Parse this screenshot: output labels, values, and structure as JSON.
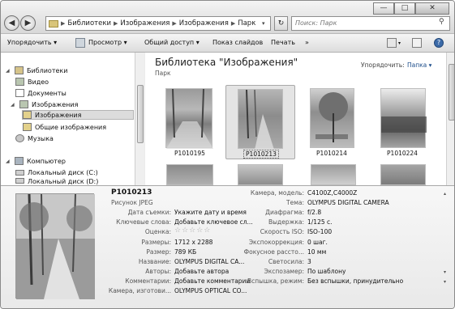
{
  "address": {
    "breadcrumb": [
      "Библиотеки",
      "Изображения",
      "Изображения",
      "Парк"
    ],
    "search_placeholder": "Поиск: Парк"
  },
  "toolbar": {
    "organize": "Упорядочить ▾",
    "view": "Просмотр ▾",
    "share": "Общий доступ ▾",
    "slideshow": "Показ слайдов",
    "print": "Печать",
    "more": "»"
  },
  "navigation": {
    "libraries": "Библиотеки",
    "video": "Видео",
    "documents": "Документы",
    "images": "Изображения",
    "images_sub": "Изображения",
    "public_images": "Общие изображения",
    "music": "Музыка",
    "computer": "Компьютер",
    "disk_c": "Локальный диск (C:)",
    "disk_d": "Локальный диск (D:)"
  },
  "content": {
    "library_title": "Библиотека \"Изображения\"",
    "library_subtitle": "Парк",
    "arrange_label": "Упорядочить:",
    "arrange_value": "Папка ▾",
    "thumbnails": [
      "P1010195",
      "P1010213",
      "P1010214",
      "P1010224"
    ]
  },
  "details": {
    "file_name": "P1010213",
    "file_type": "Рисунок JPEG",
    "left_properties": [
      {
        "label": "Дата съемки:",
        "value": "Укажите дату и время"
      },
      {
        "label": "Ключевые слова:",
        "value": "Добавьте ключевое сл..."
      },
      {
        "label": "Оценка:",
        "value": "☆☆☆☆☆"
      },
      {
        "label": "Размеры:",
        "value": "1712 x 2288"
      },
      {
        "label": "Размер:",
        "value": "789 КБ"
      },
      {
        "label": "Название:",
        "value": "OLYMPUS DIGITAL CA..."
      },
      {
        "label": "Авторы:",
        "value": "Добавьте автора"
      },
      {
        "label": "Комментарии:",
        "value": "Добавьте комментарии"
      },
      {
        "label": "Камера, изготови...",
        "value": "OLYMPUS OPTICAL CO..."
      }
    ],
    "right_properties": [
      {
        "label": "Камера, модель:",
        "value": "C4100Z,C4000Z"
      },
      {
        "label": "Тема:",
        "value": "OLYMPUS DIGITAL CAMERA"
      },
      {
        "label": "Диафрагма:",
        "value": "f/2.8"
      },
      {
        "label": "Выдержка:",
        "value": "1/125 с."
      },
      {
        "label": "Скорость ISO:",
        "value": "ISO-100"
      },
      {
        "label": "Экспокоррекция:",
        "value": "0 шаг."
      },
      {
        "label": "Фокусное рассто...",
        "value": "10 мм"
      },
      {
        "label": "Светосила:",
        "value": "3"
      },
      {
        "label": "Экспозамер:",
        "value": "По шаблону"
      },
      {
        "label": "Вспышка, режим:",
        "value": "Без вспышки, принудительно"
      }
    ]
  },
  "window_buttons": {
    "minimize": "—",
    "maximize": "□",
    "close": "✕"
  }
}
